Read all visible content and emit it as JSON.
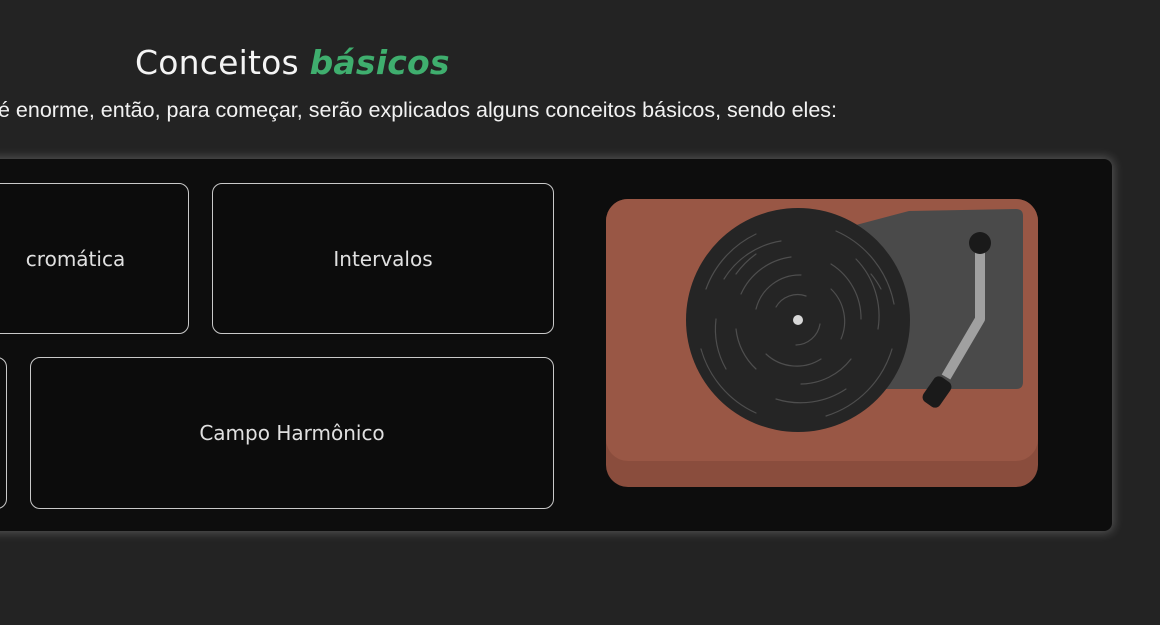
{
  "section": {
    "title_prefix": "Conceitos",
    "title_accent": "básicos",
    "intro": "é enorme, então, para começar, serão explicados alguns conceitos básicos, sendo eles:"
  },
  "concepts": {
    "chromatic_scale": "cromática",
    "intervals": "Intervalos",
    "harmonic_field": "Campo Harmônico"
  },
  "illustration": {
    "icon": "record-player-icon"
  },
  "colors": {
    "background": "#232323",
    "panel": "#0d0d0d",
    "accent": "#3fae6e",
    "turntable_body": "#995745",
    "vinyl": "#252525"
  }
}
